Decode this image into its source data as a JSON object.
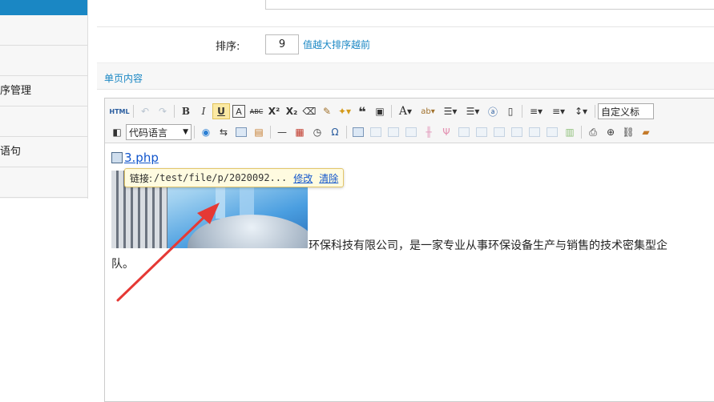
{
  "sidebar": {
    "items": [
      {
        "label": ""
      },
      {
        "label": ""
      },
      {
        "label": "序管理"
      },
      {
        "label": ""
      },
      {
        "label": "语句"
      },
      {
        "label": ""
      }
    ]
  },
  "form": {
    "sort_label": "排序:",
    "sort_value": "9",
    "sort_hint": "值越大排序越前",
    "section_title": "单页内容"
  },
  "toolbar": {
    "html_label": "HTML",
    "bold": "B",
    "italic": "I",
    "underline": "U",
    "fontborder": "A",
    "strike": "ABC",
    "superscript": "X²",
    "subscript": "X₂",
    "quote": "❝",
    "fontcolor": "A",
    "code_language": "代码语言",
    "custom_title": "自定义标"
  },
  "content": {
    "file_name": "3.php",
    "popup_label": "链接:",
    "popup_url": "/test/file/p/2020092...",
    "popup_edit": "修改",
    "popup_clear": "清除",
    "paragraph_line1": "环保科技有限公司，是一家专业从事环保设备生产与销售的技术密集型企",
    "paragraph_line2": "队。"
  },
  "colors": {
    "accent": "#1a87c4",
    "arrow": "#e53935",
    "popup_bg": "#fffbe0"
  }
}
